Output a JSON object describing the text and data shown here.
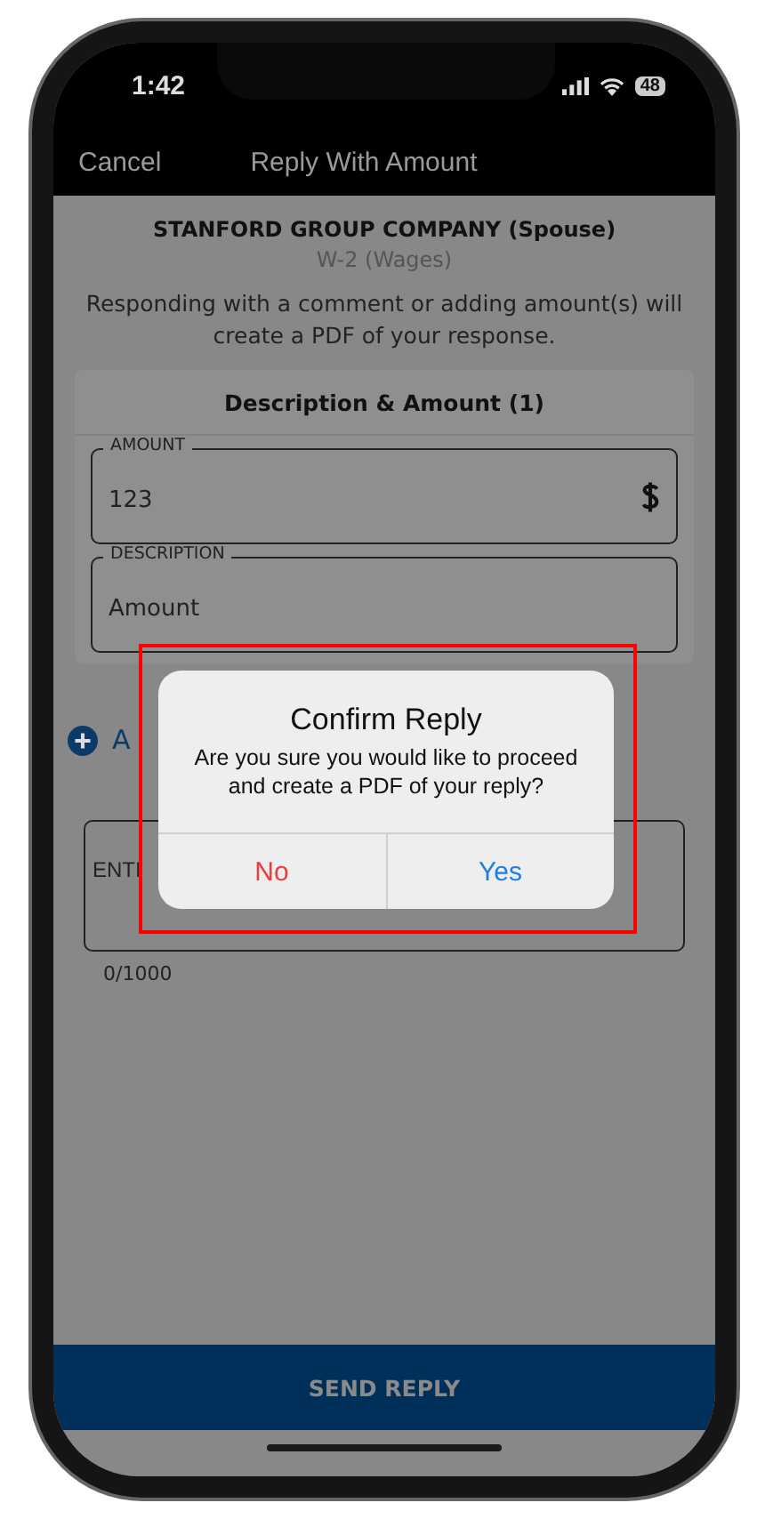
{
  "status_bar": {
    "time": "1:42",
    "battery": "48"
  },
  "nav_bar": {
    "cancel": "Cancel",
    "title": "Reply With Amount"
  },
  "header": {
    "company": "STANFORD GROUP COMPANY (Spouse)",
    "form": "W-2 (Wages)",
    "notice": "Responding with a comment or adding amount(s) will create a PDF of your response."
  },
  "card": {
    "title": "Description & Amount (1)",
    "fields": [
      {
        "label": "AMOUNT",
        "value": "123",
        "kind": "currency"
      },
      {
        "label": "DESCRIPTION",
        "value": "Amount",
        "kind": "text"
      }
    ]
  },
  "add_link": "A",
  "comment_field": {
    "placeholder": "ENTI"
  },
  "counter": "0/1000",
  "send_button": "SEND REPLY",
  "dialog": {
    "title": "Confirm Reply",
    "message": "Are you sure you would like to proceed and create a PDF of your reply?",
    "buttons": [
      {
        "label": "No",
        "kind": "destructive"
      },
      {
        "label": "Yes",
        "kind": "default"
      }
    ]
  }
}
